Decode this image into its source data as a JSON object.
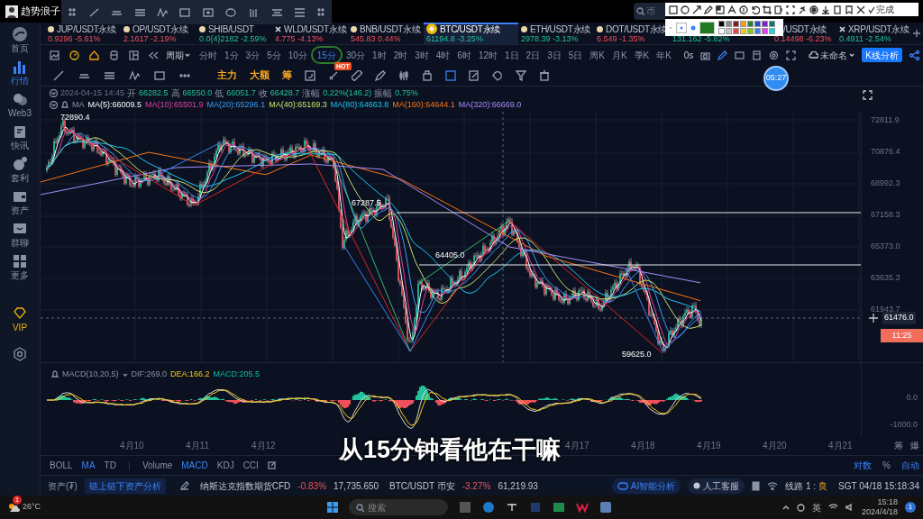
{
  "app": {
    "title": "趋势浪子"
  },
  "search": {
    "placeholder": "币"
  },
  "annotation_toolbar": {
    "done_label": "完成",
    "swatches": [
      {
        "color": "#1f7a1f",
        "selected": true
      },
      {
        "color": "#000000",
        "selected": false
      },
      {
        "color": "#8a8a8a",
        "selected": false
      },
      {
        "color": "#7f1d1d",
        "selected": false
      },
      {
        "color": "#f59e0b",
        "selected": false
      },
      {
        "color": "#2e7d32",
        "selected": false
      },
      {
        "color": "#1d4ed8",
        "selected": false
      },
      {
        "color": "#7e22ce",
        "selected": false
      },
      {
        "color": "#0f766e",
        "selected": false
      },
      {
        "color": "#ffffff",
        "selected": false
      },
      {
        "color": "#c8c8c8",
        "selected": false
      },
      {
        "color": "#ef4444",
        "selected": false
      },
      {
        "color": "#facc15",
        "selected": false
      },
      {
        "color": "#84cc16",
        "selected": false
      },
      {
        "color": "#3b82f6",
        "selected": false
      },
      {
        "color": "#e040fb",
        "selected": false
      },
      {
        "color": "#22d3ee",
        "selected": false
      }
    ]
  },
  "sidebar": [
    {
      "label": "首页",
      "kind": "nav",
      "selected": false
    },
    {
      "label": "行情",
      "kind": "nav",
      "selected": true
    },
    {
      "label": "Web3",
      "kind": "nav",
      "selected": false
    },
    {
      "label": "快讯",
      "kind": "nav",
      "selected": false
    },
    {
      "label": "套利",
      "kind": "nav",
      "selected": false
    },
    {
      "label": "资产",
      "kind": "nav",
      "selected": false
    },
    {
      "label": "群聊",
      "kind": "nav",
      "selected": false
    },
    {
      "label": "更多",
      "kind": "nav",
      "selected": false
    },
    {
      "label": "VIP",
      "kind": "vip",
      "selected": false
    }
  ],
  "tickers": [
    {
      "symbol": "JUP/USDT永续",
      "price": "0.9296",
      "change": "-5.61%",
      "falling": true,
      "kind": "coin",
      "selected": false
    },
    {
      "symbol": "OP/USDT永续",
      "price": "2.1617",
      "change": "-2.19%",
      "falling": true,
      "kind": "coin",
      "selected": false
    },
    {
      "symbol": "SHIB/USDT",
      "price": "0.0{4}2182",
      "change": "-2.59%",
      "falling": false,
      "kind": "coin",
      "selected": false
    },
    {
      "symbol": "WLD/USDT永续",
      "price": "4.775",
      "change": "-4.13%",
      "falling": true,
      "kind": "cross",
      "selected": false
    },
    {
      "symbol": "BNB/USDT永续",
      "price": "545.83",
      "change": "0.44%",
      "falling": true,
      "kind": "coin",
      "selected": false
    },
    {
      "symbol": "BTC/USDT永续",
      "price": "61194.8",
      "change": "-3.25%",
      "falling": false,
      "kind": "coin",
      "selected": true
    },
    {
      "symbol": "ETH/USDT永续",
      "price": "2978.39",
      "change": "-3.13%",
      "falling": false,
      "kind": "coin",
      "selected": false
    },
    {
      "symbol": "DOT/USDT永续",
      "price": "6.549",
      "change": "-1.35%",
      "falling": true,
      "kind": "coin",
      "selected": false
    },
    {
      "price": "131.162",
      "change": "-5.82%",
      "falling": false,
      "kind": "coin",
      "selected": false
    },
    {
      "symbol": "/USDT永续",
      "price": "0.14498",
      "change": "-6.23%",
      "falling": true,
      "kind": "coin",
      "selected": false
    },
    {
      "symbol": "XRP/USDT永续",
      "price": "0.4911",
      "change": "-2.54%",
      "falling": false,
      "kind": "cross",
      "selected": false
    }
  ],
  "period_menu": "周期",
  "periods": [
    {
      "label": "分时",
      "selected": false
    },
    {
      "label": "1分",
      "selected": false
    },
    {
      "label": "3分",
      "selected": false
    },
    {
      "label": "5分",
      "selected": false
    },
    {
      "label": "10分",
      "selected": false
    },
    {
      "label": "15分",
      "selected": true
    },
    {
      "label": "30分",
      "selected": false
    },
    {
      "label": "1时",
      "selected": false
    },
    {
      "label": "2时",
      "selected": false
    },
    {
      "label": "3时",
      "selected": false
    },
    {
      "label": "4时",
      "selected": false
    },
    {
      "label": "6时",
      "selected": false
    },
    {
      "label": "12时",
      "selected": false
    },
    {
      "label": "1日",
      "selected": false
    },
    {
      "label": "2日",
      "selected": false
    },
    {
      "label": "3日",
      "selected": false
    },
    {
      "label": "5日",
      "selected": false
    },
    {
      "label": "周K",
      "selected": false
    },
    {
      "label": "月K",
      "selected": false
    },
    {
      "label": "季K",
      "selected": false
    },
    {
      "label": "年K",
      "selected": false
    }
  ],
  "toolbar_right": {
    "refresh": "0s",
    "layout_name": "未命名",
    "analysis_button": "K线分析"
  },
  "shortcuts": [
    "主力",
    "大额",
    "筹"
  ],
  "hot_badge": "HOT",
  "timer_bubble": "05:27",
  "ohlc": {
    "datetime": "2024-04-15 14:45",
    "items": [
      {
        "label": "开",
        "value": "66282.5"
      },
      {
        "label": "高",
        "value": "66550.0"
      },
      {
        "label": "低",
        "value": "66051.7"
      },
      {
        "label": "收",
        "value": "66428.7"
      },
      {
        "label": "涨幅",
        "value": "0.22%(146.2)"
      },
      {
        "label": "振幅",
        "value": "0.75%"
      }
    ]
  },
  "ma_legend": {
    "label": "MA",
    "items": [
      "MA(5):66009.5",
      "MA(10):65501.9",
      "MA(20):65296.1",
      "MA(40):65169.3",
      "MA(80):64663.8",
      "MA(160):64644.1",
      "MA(320):66669.0"
    ]
  },
  "price_axis": [
    "72811.9",
    "70876.4",
    "68992.3",
    "67158.3",
    "65373.0",
    "63635.3",
    "61943.7"
  ],
  "current_price": "61476.0",
  "countdown": "11:25",
  "price_marks": [
    "72890.4",
    "67287.5",
    "64405.0",
    "59625.0"
  ],
  "macd": {
    "title": "MACD(10,20,5)",
    "items": [
      "DIF:269.0",
      "DEA:166.2",
      "MACD:205.5"
    ],
    "axis": [
      "0.0",
      "-1000.0"
    ]
  },
  "date_axis": [
    [
      "4月10",
      "4月11",
      "4月12"
    ],
    [
      "4月17",
      "4月18",
      "4月19",
      "4月20",
      "4月21"
    ]
  ],
  "axis_corner": [
    "筹",
    "爆"
  ],
  "subtitle": "从15分钟看他在干嘛",
  "indicators": {
    "main": [
      {
        "label": "BOLL",
        "selected": false
      },
      {
        "label": "MA",
        "selected": true
      },
      {
        "label": "TD",
        "selected": false
      }
    ],
    "sub": [
      {
        "label": "Volume",
        "selected": false
      },
      {
        "label": "MACD",
        "selected": true
      },
      {
        "label": "KDJ",
        "selected": false
      },
      {
        "label": "CCI",
        "selected": false
      }
    ]
  },
  "scale_options": [
    {
      "label": "对数",
      "selected": true
    },
    {
      "label": "%",
      "selected": false
    },
    {
      "label": "自动",
      "selected": true
    }
  ],
  "status_bar": {
    "assets": "资产(₮)",
    "asset_analysis": "链上链下资产分析",
    "quotes": [
      {
        "name": "纳斯达克指数期货CFD",
        "change": "-0.83%",
        "price": "17,735.650"
      },
      {
        "name": "BTC/USDT 币安",
        "change": "-3.27%",
        "price": "61,219.93"
      }
    ],
    "ai_button": "AI智能分析",
    "support_button": "人工客服",
    "line_label": "线路 1 :",
    "line_quality": "良",
    "clock": "SGT 04/18 15:18:34"
  },
  "taskbar": {
    "weather": "26°C",
    "weather_badge": "1",
    "search_placeholder": "搜索",
    "ime": "英",
    "time": "15:18",
    "date": "2024/4/18",
    "notifications": "1"
  }
}
